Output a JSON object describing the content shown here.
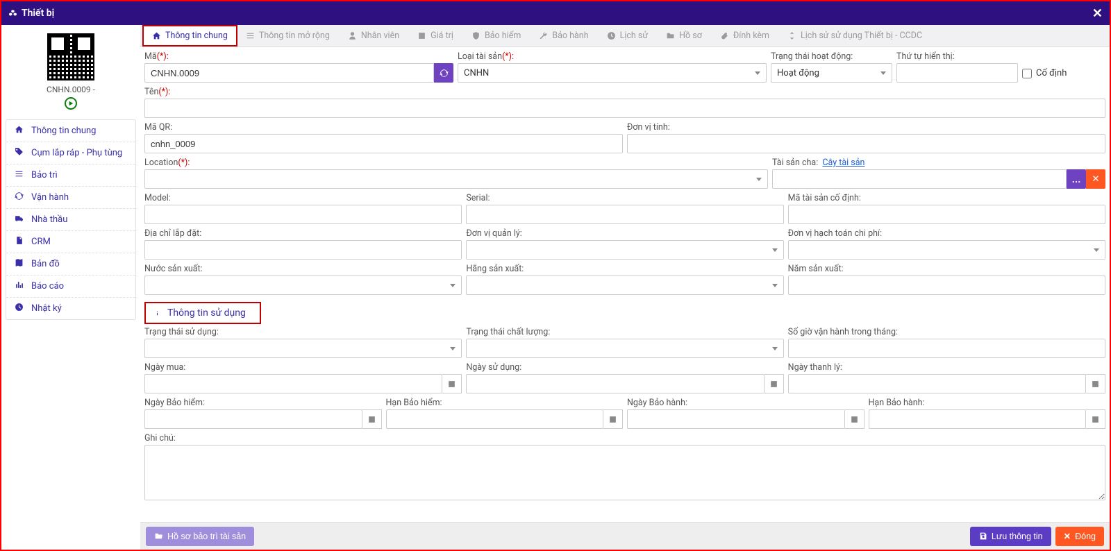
{
  "header": {
    "title": "Thiết bị"
  },
  "qr": {
    "label": "CNHN.0009 -"
  },
  "sidebar": {
    "items": [
      {
        "label": "Thông tin chung"
      },
      {
        "label": "Cụm lắp ráp - Phụ tùng"
      },
      {
        "label": "Bảo trì"
      },
      {
        "label": "Vận hành"
      },
      {
        "label": "Nhà thầu"
      },
      {
        "label": "CRM"
      },
      {
        "label": "Bản đồ"
      },
      {
        "label": "Báo cáo"
      },
      {
        "label": "Nhật ký"
      }
    ]
  },
  "tabs": [
    {
      "label": "Thông tin chung"
    },
    {
      "label": "Thông tin mở rộng"
    },
    {
      "label": "Nhân viên"
    },
    {
      "label": "Giá trị"
    },
    {
      "label": "Bảo hiểm"
    },
    {
      "label": "Bảo hành"
    },
    {
      "label": "Lịch sử"
    },
    {
      "label": "Hồ sơ"
    },
    {
      "label": "Đính kèm"
    },
    {
      "label": "Lịch sử sử dụng Thiết bị - CCDC"
    }
  ],
  "labels": {
    "ma": "Mã",
    "loai_tai_san": "Loại tài sản",
    "trang_thai_hoat_dong": "Trạng thái hoạt động:",
    "thu_tu_hien_thi": "Thứ tự hiển thị:",
    "co_dinh": "Cố định",
    "ten": "Tên",
    "ma_qr": "Mã QR:",
    "don_vi_tinh": "Đơn vị tính:",
    "location": "Location",
    "tai_san_cha": "Tài sản cha:",
    "tree_link": "Cây tài sản",
    "model": "Model:",
    "serial": "Serial:",
    "ma_ts_co_dinh": "Mã tài sản cố định:",
    "dia_chi_lap_dat": "Địa chỉ lắp đặt:",
    "don_vi_quan_ly": "Đơn vị quản lý:",
    "don_vi_hach_toan": "Đơn vị hạch toán chi phí:",
    "nuoc_sx": "Nước sản xuất:",
    "hang_sx": "Hãng sản xuất:",
    "nam_sx": "Năm sản xuất:",
    "thong_tin_su_dung": "Thông tin sử dụng",
    "trang_thai_su_dung": "Trạng thái sử dụng:",
    "trang_thai_chat_luong": "Trạng thái chất lượng:",
    "so_gio_van_hanh": "Số giờ vận hành trong tháng:",
    "ngay_mua": "Ngày mua:",
    "ngay_su_dung": "Ngày sử dụng:",
    "ngay_thanh_ly": "Ngày thanh lý:",
    "ngay_bao_hiem": "Ngày Bảo hiểm:",
    "han_bao_hiem": "Hạn Bảo hiểm:",
    "ngay_bao_hanh": "Ngày Bảo hành:",
    "han_bao_hanh": "Hạn Bảo hành:",
    "ghi_chu": "Ghi chú:"
  },
  "values": {
    "ma": "CNHN.0009",
    "loai_tai_san": "CNHN",
    "trang_thai_hoat_dong": "Hoạt động",
    "ma_qr": "cnhn_0009"
  },
  "footer": {
    "left": "Hồ sơ bảo trì tài sản",
    "save": "Lưu thông tin",
    "close": "Đóng"
  }
}
